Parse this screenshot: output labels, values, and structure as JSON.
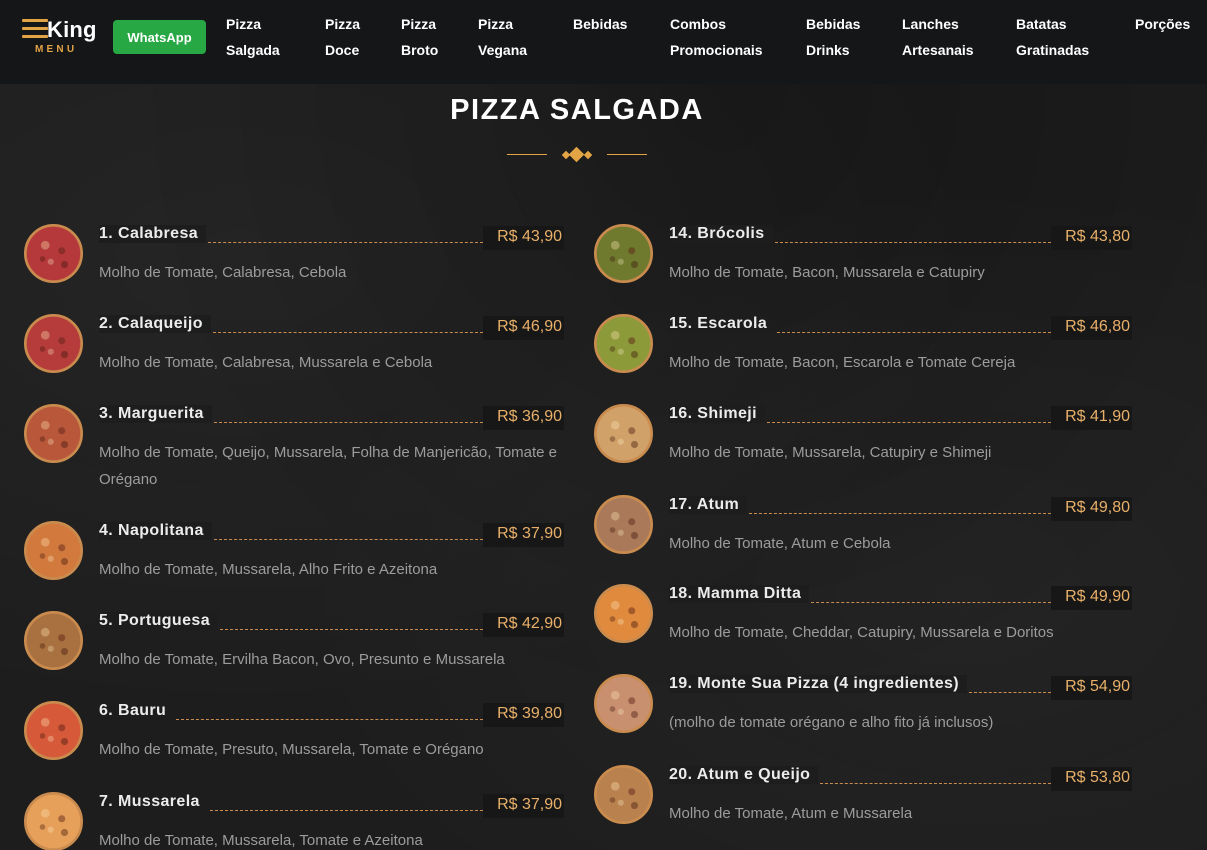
{
  "logo": {
    "king": "King",
    "menu": "MENU"
  },
  "whatsapp": "WhatsApp",
  "nav": [
    "Pizza\nSalgada",
    "Pizza\nDoce",
    "Pizza\nBroto",
    "Pizza\nVegana",
    "Bebidas",
    "Combos\nPromocionais",
    "Bebidas\nDrinks",
    "Lanches\nArtesanais",
    "Batatas\nGratinadas",
    "Porções"
  ],
  "section_title": "PIZZA SALGADA",
  "accent_color": "#e3a446",
  "items_left": [
    {
      "name": "1. Calabresa",
      "price": "R$ 43,90",
      "desc": "Molho de Tomate, Calabresa, Cebola",
      "icon": "pizza-calabresa-icon",
      "color": "#b5393a"
    },
    {
      "name": "2. Calaqueijo",
      "price": "R$ 46,90",
      "desc": "Molho de Tomate, Calabresa, Mussarela e Cebola",
      "icon": "pizza-calaqueijo-icon",
      "color": "#b53c3a"
    },
    {
      "name": "3. Marguerita",
      "price": "R$ 36,90",
      "desc": "Molho de Tomate, Queijo, Mussarela, Folha de Manjericão, Tomate e Orégano",
      "icon": "pizza-marguerita-icon",
      "color": "#b9573a"
    },
    {
      "name": "4. Napolitana",
      "price": "R$ 37,90",
      "desc": "Molho de Tomate, Mussarela, Alho Frito e Azeitona",
      "icon": "pizza-napolitana-icon",
      "color": "#d27a3e"
    },
    {
      "name": "5. Portuguesa",
      "price": "R$ 42,90",
      "desc": "Molho de Tomate, Ervilha Bacon, Ovo, Presunto e Mussarela",
      "icon": "pizza-portuguesa-icon",
      "color": "#a9713f"
    },
    {
      "name": "6. Bauru",
      "price": "R$ 39,80",
      "desc": "Molho de Tomate, Presuto, Mussarela, Tomate e Orégano",
      "icon": "pizza-bauru-icon",
      "color": "#d6593a"
    },
    {
      "name": "7. Mussarela",
      "price": "R$ 37,90",
      "desc": "Molho de Tomate, Mussarela, Tomate e Azeitona",
      "icon": "pizza-mussarela-icon",
      "color": "#e6a05a"
    }
  ],
  "items_right": [
    {
      "name": "14. Brócolis",
      "price": "R$ 43,80",
      "desc": "Molho de Tomate, Bacon, Mussarela e Catupiry",
      "icon": "pizza-brocolis-icon",
      "color": "#6f7a2e"
    },
    {
      "name": "15. Escarola",
      "price": "R$ 46,80",
      "desc": "Molho de Tomate, Bacon, Escarola e Tomate Cereja",
      "icon": "pizza-escarola-icon",
      "color": "#8d9a3a"
    },
    {
      "name": "16. Shimeji",
      "price": "R$ 41,90",
      "desc": "Molho de Tomate, Mussarela, Catupiry e Shimeji",
      "icon": "pizza-shimeji-icon",
      "color": "#d1a16a"
    },
    {
      "name": "17. Atum",
      "price": "R$ 49,80",
      "desc": "Molho de Tomate, Atum e Cebola",
      "icon": "pizza-atum-icon",
      "color": "#a9795a"
    },
    {
      "name": "18. Mamma Ditta",
      "price": "R$ 49,90",
      "desc": "Molho de Tomate, Cheddar, Catupiry, Mussarela e Doritos",
      "icon": "pizza-mamma-ditta-icon",
      "color": "#e08a3e"
    },
    {
      "name": "19. Monte Sua Pizza (4 ingredientes)",
      "price": "R$ 54,90",
      "desc": "(molho de tomate orégano e alho fito já inclusos)",
      "icon": "pizza-monte-sua-icon",
      "color": "#c99070"
    },
    {
      "name": "20. Atum e Queijo",
      "price": "R$ 53,80",
      "desc": "Molho de Tomate, Atum e Mussarela",
      "icon": "pizza-atum-queijo-icon",
      "color": "#b9814e"
    }
  ]
}
